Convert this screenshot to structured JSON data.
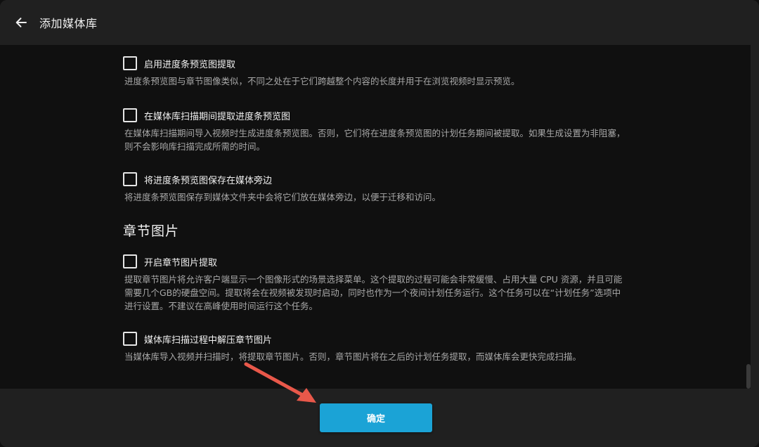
{
  "header": {
    "title": "添加媒体库",
    "back_icon": "arrow-left-icon"
  },
  "options_part1": [
    {
      "label": "启用进度条预览图提取",
      "desc": "进度条预览图与章节图像类似，不同之处在于它们跨越整个内容的长度并用于在浏览视频时显示预览。",
      "checked": false
    },
    {
      "label": "在媒体库扫描期间提取进度条预览图",
      "desc": "在媒体库扫描期间导入视频时生成进度条预览图。否则，它们将在进度条预览图的计划任务期间被提取。如果生成设置为非阻塞，则不会影响库扫描完成所需的时间。",
      "checked": false
    },
    {
      "label": "将进度条预览图保存在媒体旁边",
      "desc": "将进度条预览图保存到媒体文件夹中会将它们放在媒体旁边，以便于迁移和访问。",
      "checked": false
    }
  ],
  "section_chapter": {
    "title": "章节图片"
  },
  "options_part2": [
    {
      "label": "开启章节图片提取",
      "desc": "提取章节图片将允许客户端显示一个图像形式的场景选择菜单。这个提取的过程可能会非常缓慢、占用大量 CPU 资源，并且可能需要几个GB的硬盘空间。提取将会在视频被发现时启动，同时也作为一个夜间计划任务运行。这个任务可以在“计划任务”选项中进行设置。不建议在高峰使用时间运行这个任务。",
      "checked": false
    },
    {
      "label": "媒体库扫描过程中解压章节图片",
      "desc": "当媒体库导入视频并扫描时，将提取章节图片。否则，章节图片将在之后的计划任务提取，而媒体库会更快完成扫描。",
      "checked": false
    }
  ],
  "footer": {
    "ok_label": "确定"
  },
  "colors": {
    "accent": "#1ba3d6",
    "annotation_arrow": "#e8584a",
    "background": "#101010",
    "chrome": "#202020"
  }
}
